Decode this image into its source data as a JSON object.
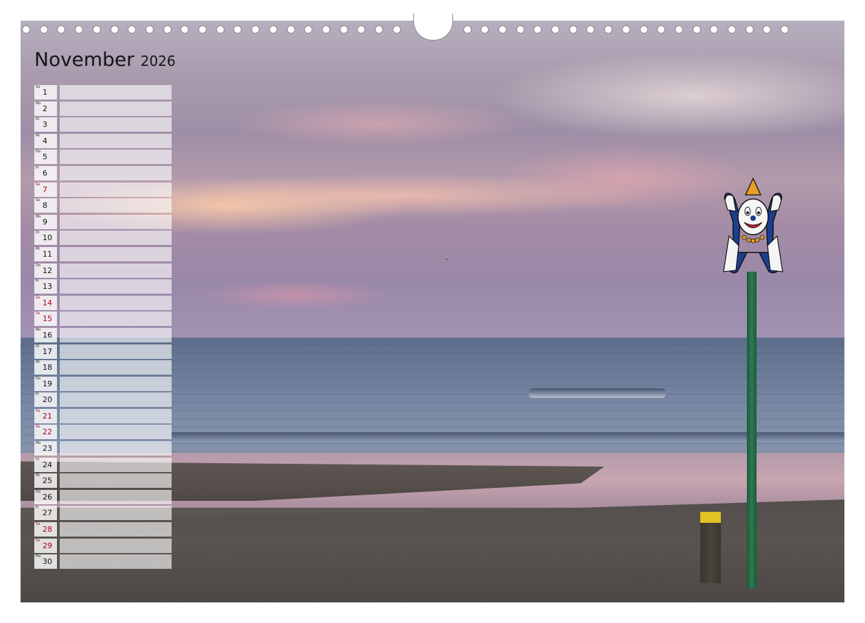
{
  "calendar": {
    "month": "November",
    "year": "2026",
    "days": [
      {
        "wd": "So",
        "d": "1",
        "red": false
      },
      {
        "wd": "Mo",
        "d": "2",
        "red": false
      },
      {
        "wd": "Di",
        "d": "3",
        "red": false
      },
      {
        "wd": "Mi",
        "d": "4",
        "red": false
      },
      {
        "wd": "Do",
        "d": "5",
        "red": false
      },
      {
        "wd": "Fr",
        "d": "6",
        "red": false
      },
      {
        "wd": "Sa",
        "d": "7",
        "red": true
      },
      {
        "wd": "So",
        "d": "8",
        "red": false
      },
      {
        "wd": "Mo",
        "d": "9",
        "red": false
      },
      {
        "wd": "Di",
        "d": "10",
        "red": false
      },
      {
        "wd": "Mi",
        "d": "11",
        "red": false
      },
      {
        "wd": "Do",
        "d": "12",
        "red": false
      },
      {
        "wd": "Fr",
        "d": "13",
        "red": false
      },
      {
        "wd": "Sa",
        "d": "14",
        "red": true
      },
      {
        "wd": "So",
        "d": "15",
        "red": true
      },
      {
        "wd": "Mo",
        "d": "16",
        "red": false
      },
      {
        "wd": "Di",
        "d": "17",
        "red": false
      },
      {
        "wd": "Mi",
        "d": "18",
        "red": false
      },
      {
        "wd": "Do",
        "d": "19",
        "red": false
      },
      {
        "wd": "Fr",
        "d": "20",
        "red": false
      },
      {
        "wd": "Sa",
        "d": "21",
        "red": true
      },
      {
        "wd": "So",
        "d": "22",
        "red": true
      },
      {
        "wd": "Mo",
        "d": "23",
        "red": false
      },
      {
        "wd": "Di",
        "d": "24",
        "red": false
      },
      {
        "wd": "Mi",
        "d": "25",
        "red": false
      },
      {
        "wd": "Do",
        "d": "26",
        "red": false
      },
      {
        "wd": "Fr",
        "d": "27",
        "red": false
      },
      {
        "wd": "Sa",
        "d": "28",
        "red": true
      },
      {
        "wd": "So",
        "d": "29",
        "red": true
      },
      {
        "wd": "Mo",
        "d": "30",
        "red": false
      }
    ]
  },
  "colors": {
    "weekend_red": "#b00018",
    "pole_green": "#1a5a3a",
    "clown_blue": "#1d3f8f"
  },
  "icons": {
    "binding": "spiral-binding-rings",
    "sign": "clown-sign-icon"
  }
}
